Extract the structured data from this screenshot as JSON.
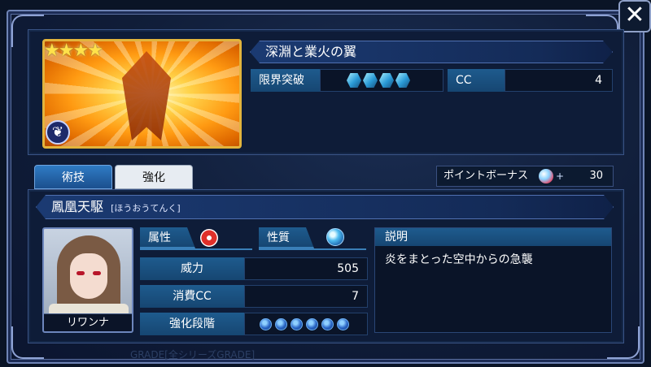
{
  "card": {
    "rarity_stars": "★★★★",
    "title": "深淵と業火の翼"
  },
  "stats": {
    "limit_break_label": "限界突破",
    "limit_break_gems": 4,
    "cc_label": "CC",
    "cc_value": "4"
  },
  "tabs": {
    "skill": "術技",
    "upgrade": "強化"
  },
  "bonus": {
    "label": "ポイントボーナス",
    "plus": "+",
    "value": "30"
  },
  "skill": {
    "name": "鳳凰天駆",
    "reading": "[ほうおうてんく]",
    "character_name": "リワンナ",
    "attribute_label": "属性",
    "nature_label": "性質",
    "power_label": "威力",
    "power_value": "505",
    "cost_label": "消費CC",
    "cost_value": "7",
    "stage_label": "強化段階",
    "stage_orbs": 6,
    "description_label": "説明",
    "description_text": "炎をまとった空中からの急襲"
  },
  "footer": {
    "grade_text": "GRADE[全シリーズGRADE]"
  },
  "colors": {
    "accent_blue": "#1e5b8e",
    "frame": "#6f84b6",
    "card_gold": "#e3b43c"
  },
  "icons": {
    "close": "close-icon",
    "type": "wing-type-icon",
    "attribute": "fire-attribute-icon",
    "nature": "water-orb-icon",
    "bonus": "bonus-gem-icon"
  }
}
